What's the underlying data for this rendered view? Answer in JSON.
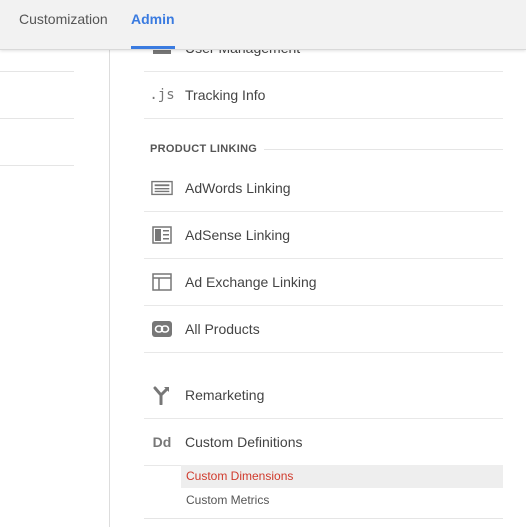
{
  "tabs": [
    {
      "label": "Customization"
    },
    {
      "label": "Admin",
      "active": true
    }
  ],
  "menu": {
    "cut_item_label": "User Management",
    "tracking_info": {
      "icon_text": ".js",
      "label": "Tracking Info"
    },
    "product_linking_header": "PRODUCT LINKING",
    "adwords": {
      "label": "AdWords Linking"
    },
    "adsense": {
      "label": "AdSense Linking"
    },
    "adexchange": {
      "label": "Ad Exchange Linking"
    },
    "all_products": {
      "label": "All Products"
    },
    "remarketing": {
      "label": "Remarketing"
    },
    "custom_definitions": {
      "icon_text": "Dd",
      "label": "Custom Definitions"
    }
  },
  "sub_items": [
    {
      "label": "Custom Dimensions",
      "active": true
    },
    {
      "label": "Custom Metrics",
      "active": false
    }
  ],
  "colors": {
    "accent": "#3a7be0",
    "active_sub": "#d03a2c",
    "icon": "#777777"
  }
}
